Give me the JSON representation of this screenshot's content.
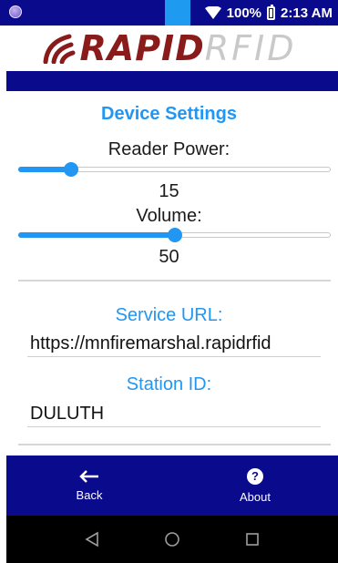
{
  "status_bar": {
    "battery": "100%",
    "time": "2:13 AM"
  },
  "logo": {
    "part1": "RAPID",
    "part2": "RFID"
  },
  "settings": {
    "title": "Device Settings",
    "reader_power": {
      "label": "Reader Power:",
      "value": "15",
      "level": 0.17
    },
    "volume": {
      "label": "Volume:",
      "value": "50",
      "level": 0.5
    }
  },
  "service_url": {
    "label": "Service URL:",
    "value": "https://mnfiremarshal.rapidrfid"
  },
  "station_id": {
    "label": "Station ID:",
    "value": "DULUTH"
  },
  "bottom_nav": {
    "back": {
      "label": "Back",
      "icon": "arrow-left-icon"
    },
    "about": {
      "label": "About",
      "icon": "help-icon"
    }
  },
  "android_nav": [
    "back-triangle-icon",
    "home-circle-icon",
    "recents-square-icon"
  ],
  "colors": {
    "primary": "#0a0a8c",
    "accent": "#2196f3",
    "logo_red": "#8a1b1b",
    "logo_gray": "#c9c9c9"
  }
}
